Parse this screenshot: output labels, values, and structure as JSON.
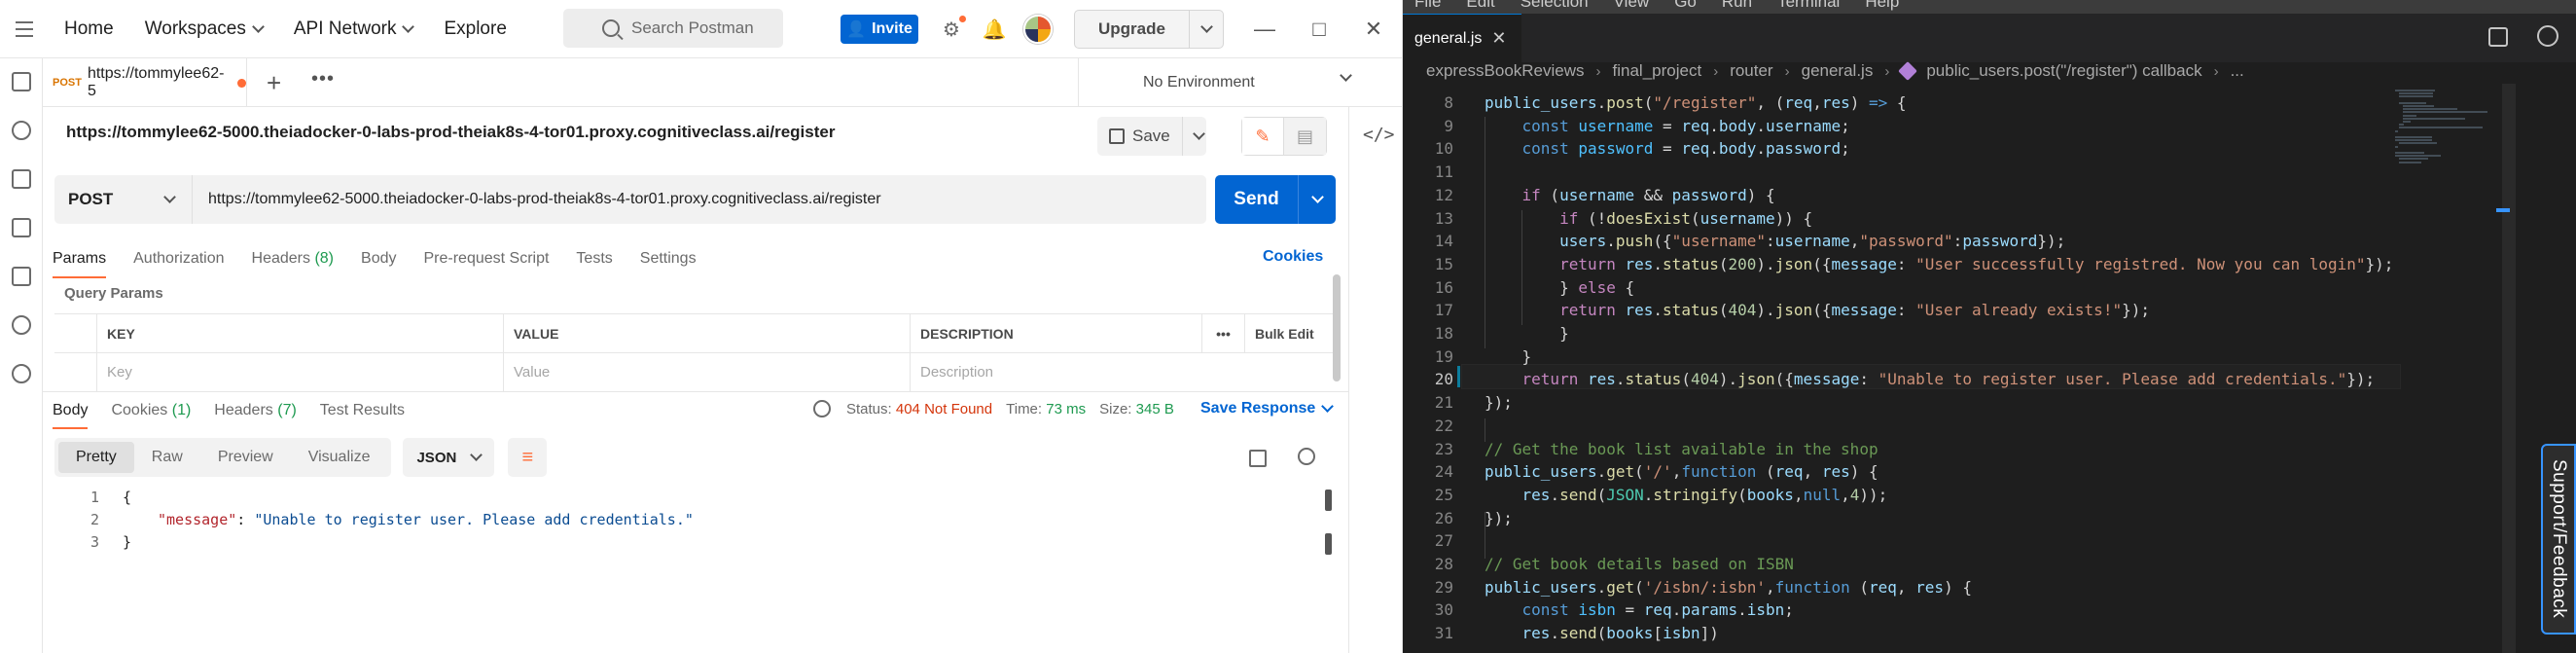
{
  "postman": {
    "nav": {
      "home": "Home",
      "workspaces": "Workspaces",
      "api_network": "API Network",
      "explore": "Explore"
    },
    "search_placeholder": "Search Postman",
    "invite_label": "Invite",
    "upgrade_label": "Upgrade",
    "tab": {
      "method": "POST",
      "title": "https://tommylee62-5"
    },
    "environment": "No Environment",
    "request_title": "https://tommylee62-5000.theiadocker-0-labs-prod-theiak8s-4-tor01.proxy.cognitiveclass.ai/register",
    "save_label": "Save",
    "method": "POST",
    "url": "https://tommylee62-5000.theiadocker-0-labs-prod-theiak8s-4-tor01.proxy.cognitiveclass.ai/register",
    "send_label": "Send",
    "request_tabs": [
      {
        "label": "Params",
        "count": ""
      },
      {
        "label": "Authorization",
        "count": ""
      },
      {
        "label": "Headers",
        "count": "(8)"
      },
      {
        "label": "Body",
        "count": ""
      },
      {
        "label": "Pre-request Script",
        "count": ""
      },
      {
        "label": "Tests",
        "count": ""
      },
      {
        "label": "Settings",
        "count": ""
      }
    ],
    "cookies_link": "Cookies",
    "query_params_label": "Query Params",
    "table": {
      "headers": {
        "key": "KEY",
        "value": "VALUE",
        "description": "DESCRIPTION",
        "more": "•••",
        "bulk_edit": "Bulk Edit"
      },
      "placeholder": {
        "key": "Key",
        "value": "Value",
        "description": "Description"
      }
    },
    "response_tabs": [
      {
        "label": "Body",
        "count": ""
      },
      {
        "label": "Cookies",
        "count": "(1)"
      },
      {
        "label": "Headers",
        "count": "(7)"
      },
      {
        "label": "Test Results",
        "count": ""
      }
    ],
    "status": {
      "label": "Status:",
      "value": "404 Not Found",
      "time_label": "Time:",
      "time": "73 ms",
      "size_label": "Size:",
      "size": "345 B"
    },
    "save_response": "Save Response",
    "view_modes": [
      "Pretty",
      "Raw",
      "Preview",
      "Visualize"
    ],
    "format": "JSON",
    "response_body": {
      "line_numbers": [
        "1",
        "2",
        "3"
      ],
      "open": "{",
      "key": "\"message\"",
      "colon": ": ",
      "value": "\"Unable to register user. Please add credentials.\"",
      "close": "}"
    }
  },
  "editor": {
    "menu": [
      "File",
      "Edit",
      "Selection",
      "View",
      "Go",
      "Run",
      "Terminal",
      "Help"
    ],
    "tab_name": "general.js",
    "breadcrumb": [
      "expressBookReviews",
      "final_project",
      "router",
      "general.js",
      "public_users.post(\"/register\") callback",
      "..."
    ],
    "support_label": "Support/Feedback",
    "lines": [
      {
        "n": "8",
        "indent": "",
        "tokens": [
          [
            "var",
            "public_users"
          ],
          [
            "pun",
            "."
          ],
          [
            "fn",
            "post"
          ],
          [
            "pun",
            "("
          ],
          [
            "str",
            "\"/register\""
          ],
          [
            "pun",
            ", ("
          ],
          [
            "var",
            "req"
          ],
          [
            "pun",
            ","
          ],
          [
            "var",
            "res"
          ],
          [
            "pun",
            ") "
          ],
          [
            "kw",
            "=>"
          ],
          [
            "pun",
            " {"
          ]
        ]
      },
      {
        "n": "9",
        "indent": "    ",
        "tokens": [
          [
            "kw",
            "const"
          ],
          [
            "pun",
            " "
          ],
          [
            "const",
            "username"
          ],
          [
            "pun",
            " = "
          ],
          [
            "var",
            "req"
          ],
          [
            "pun",
            "."
          ],
          [
            "var",
            "body"
          ],
          [
            "pun",
            "."
          ],
          [
            "var",
            "username"
          ],
          [
            "pun",
            ";"
          ]
        ]
      },
      {
        "n": "10",
        "indent": "    ",
        "tokens": [
          [
            "kw",
            "const"
          ],
          [
            "pun",
            " "
          ],
          [
            "const",
            "password"
          ],
          [
            "pun",
            " = "
          ],
          [
            "var",
            "req"
          ],
          [
            "pun",
            "."
          ],
          [
            "var",
            "body"
          ],
          [
            "pun",
            "."
          ],
          [
            "var",
            "password"
          ],
          [
            "pun",
            ";"
          ]
        ]
      },
      {
        "n": "11",
        "indent": "",
        "tokens": []
      },
      {
        "n": "12",
        "indent": "    ",
        "tokens": [
          [
            "ctl",
            "if"
          ],
          [
            "pun",
            " ("
          ],
          [
            "var",
            "username"
          ],
          [
            "pun",
            " && "
          ],
          [
            "var",
            "password"
          ],
          [
            "pun",
            ") {"
          ]
        ]
      },
      {
        "n": "13",
        "indent": "        ",
        "tokens": [
          [
            "ctl",
            "if"
          ],
          [
            "pun",
            " (!"
          ],
          [
            "fn",
            "doesExist"
          ],
          [
            "pun",
            "("
          ],
          [
            "var",
            "username"
          ],
          [
            "pun",
            ")) {"
          ]
        ]
      },
      {
        "n": "14",
        "indent": "        ",
        "tokens": [
          [
            "var",
            "users"
          ],
          [
            "pun",
            "."
          ],
          [
            "fn",
            "push"
          ],
          [
            "pun",
            "({"
          ],
          [
            "str",
            "\"username\""
          ],
          [
            "pun",
            ":"
          ],
          [
            "var",
            "username"
          ],
          [
            "pun",
            ","
          ],
          [
            "str",
            "\"password\""
          ],
          [
            "pun",
            ":"
          ],
          [
            "var",
            "password"
          ],
          [
            "pun",
            "});"
          ]
        ]
      },
      {
        "n": "15",
        "indent": "        ",
        "tokens": [
          [
            "ctl",
            "return"
          ],
          [
            "pun",
            " "
          ],
          [
            "var",
            "res"
          ],
          [
            "pun",
            "."
          ],
          [
            "fn",
            "status"
          ],
          [
            "pun",
            "("
          ],
          [
            "num",
            "200"
          ],
          [
            "pun",
            ")."
          ],
          [
            "fn",
            "json"
          ],
          [
            "pun",
            "({"
          ],
          [
            "var",
            "message"
          ],
          [
            "pun",
            ": "
          ],
          [
            "str",
            "\"User successfully registred. Now you can login\""
          ],
          [
            "pun",
            "});"
          ]
        ]
      },
      {
        "n": "16",
        "indent": "        ",
        "tokens": [
          [
            "pun",
            "} "
          ],
          [
            "ctl",
            "else"
          ],
          [
            "pun",
            " {"
          ]
        ]
      },
      {
        "n": "17",
        "indent": "        ",
        "tokens": [
          [
            "ctl",
            "return"
          ],
          [
            "pun",
            " "
          ],
          [
            "var",
            "res"
          ],
          [
            "pun",
            "."
          ],
          [
            "fn",
            "status"
          ],
          [
            "pun",
            "("
          ],
          [
            "num",
            "404"
          ],
          [
            "pun",
            ")."
          ],
          [
            "fn",
            "json"
          ],
          [
            "pun",
            "({"
          ],
          [
            "var",
            "message"
          ],
          [
            "pun",
            ": "
          ],
          [
            "str",
            "\"User already exists!\""
          ],
          [
            "pun",
            "});"
          ]
        ]
      },
      {
        "n": "18",
        "indent": "        ",
        "tokens": [
          [
            "pun",
            "}"
          ]
        ]
      },
      {
        "n": "19",
        "indent": "    ",
        "tokens": [
          [
            "pun",
            "}"
          ]
        ]
      },
      {
        "n": "20",
        "indent": "    ",
        "tokens": [
          [
            "ctl",
            "return"
          ],
          [
            "pun",
            " "
          ],
          [
            "var",
            "res"
          ],
          [
            "pun",
            "."
          ],
          [
            "fn",
            "status"
          ],
          [
            "pun",
            "("
          ],
          [
            "num",
            "404"
          ],
          [
            "pun",
            ")."
          ],
          [
            "fn",
            "json"
          ],
          [
            "pun",
            "({"
          ],
          [
            "var",
            "message"
          ],
          [
            "pun",
            ": "
          ],
          [
            "str",
            "\"Unable to register user. Please add credentials.\""
          ],
          [
            "pun",
            "});"
          ]
        ]
      },
      {
        "n": "21",
        "indent": "",
        "tokens": [
          [
            "pun",
            "});"
          ]
        ]
      },
      {
        "n": "22",
        "indent": "",
        "tokens": []
      },
      {
        "n": "23",
        "indent": "",
        "tokens": [
          [
            "cm",
            "// Get the book list available in the shop"
          ]
        ]
      },
      {
        "n": "24",
        "indent": "",
        "tokens": [
          [
            "var",
            "public_users"
          ],
          [
            "pun",
            "."
          ],
          [
            "fn",
            "get"
          ],
          [
            "pun",
            "("
          ],
          [
            "str",
            "'/'"
          ],
          [
            "pun",
            ","
          ],
          [
            "kw",
            "function"
          ],
          [
            "pun",
            " ("
          ],
          [
            "var",
            "req"
          ],
          [
            "pun",
            ", "
          ],
          [
            "var",
            "res"
          ],
          [
            "pun",
            ") {"
          ]
        ]
      },
      {
        "n": "25",
        "indent": "    ",
        "tokens": [
          [
            "var",
            "res"
          ],
          [
            "pun",
            "."
          ],
          [
            "fn",
            "send"
          ],
          [
            "pun",
            "("
          ],
          [
            "cls",
            "JSON"
          ],
          [
            "pun",
            "."
          ],
          [
            "fn",
            "stringify"
          ],
          [
            "pun",
            "("
          ],
          [
            "var",
            "books"
          ],
          [
            "pun",
            ","
          ],
          [
            "kw",
            "null"
          ],
          [
            "pun",
            ","
          ],
          [
            "num",
            "4"
          ],
          [
            "pun",
            "));"
          ]
        ]
      },
      {
        "n": "26",
        "indent": "",
        "tokens": [
          [
            "pun",
            "});"
          ]
        ]
      },
      {
        "n": "27",
        "indent": "",
        "tokens": []
      },
      {
        "n": "28",
        "indent": "",
        "tokens": [
          [
            "cm",
            "// Get book details based on ISBN"
          ]
        ]
      },
      {
        "n": "29",
        "indent": "",
        "tokens": [
          [
            "var",
            "public_users"
          ],
          [
            "pun",
            "."
          ],
          [
            "fn",
            "get"
          ],
          [
            "pun",
            "("
          ],
          [
            "str",
            "'/isbn/:isbn'"
          ],
          [
            "pun",
            ","
          ],
          [
            "kw",
            "function"
          ],
          [
            "pun",
            " ("
          ],
          [
            "var",
            "req"
          ],
          [
            "pun",
            ", "
          ],
          [
            "var",
            "res"
          ],
          [
            "pun",
            ") {"
          ]
        ]
      },
      {
        "n": "30",
        "indent": "    ",
        "tokens": [
          [
            "kw",
            "const"
          ],
          [
            "pun",
            " "
          ],
          [
            "const",
            "isbn"
          ],
          [
            "pun",
            " = "
          ],
          [
            "var",
            "req"
          ],
          [
            "pun",
            "."
          ],
          [
            "var",
            "params"
          ],
          [
            "pun",
            "."
          ],
          [
            "var",
            "isbn"
          ],
          [
            "pun",
            ";"
          ]
        ]
      },
      {
        "n": "31",
        "indent": "    ",
        "tokens": [
          [
            "var",
            "res"
          ],
          [
            "pun",
            "."
          ],
          [
            "fn",
            "send"
          ],
          [
            "pun",
            "("
          ],
          [
            "var",
            "books"
          ],
          [
            "pun",
            "["
          ],
          [
            "var",
            "isbn"
          ],
          [
            "pun",
            "])"
          ]
        ]
      }
    ],
    "current_line": "20"
  }
}
